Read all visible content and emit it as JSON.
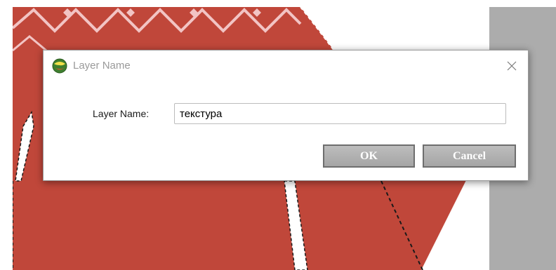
{
  "dialog": {
    "title": "Layer Name",
    "field_label": "Layer Name:",
    "field_value": "текстура",
    "ok_label": "OK",
    "cancel_label": "Cancel"
  },
  "icons": {
    "app": "app-logo-icon",
    "close": "close-icon"
  },
  "colors": {
    "sweater_red": "#c0473a",
    "pattern_pink": "#f2c4c4",
    "panel_gray": "#acacac",
    "button_gray": "#b3b3b3"
  }
}
